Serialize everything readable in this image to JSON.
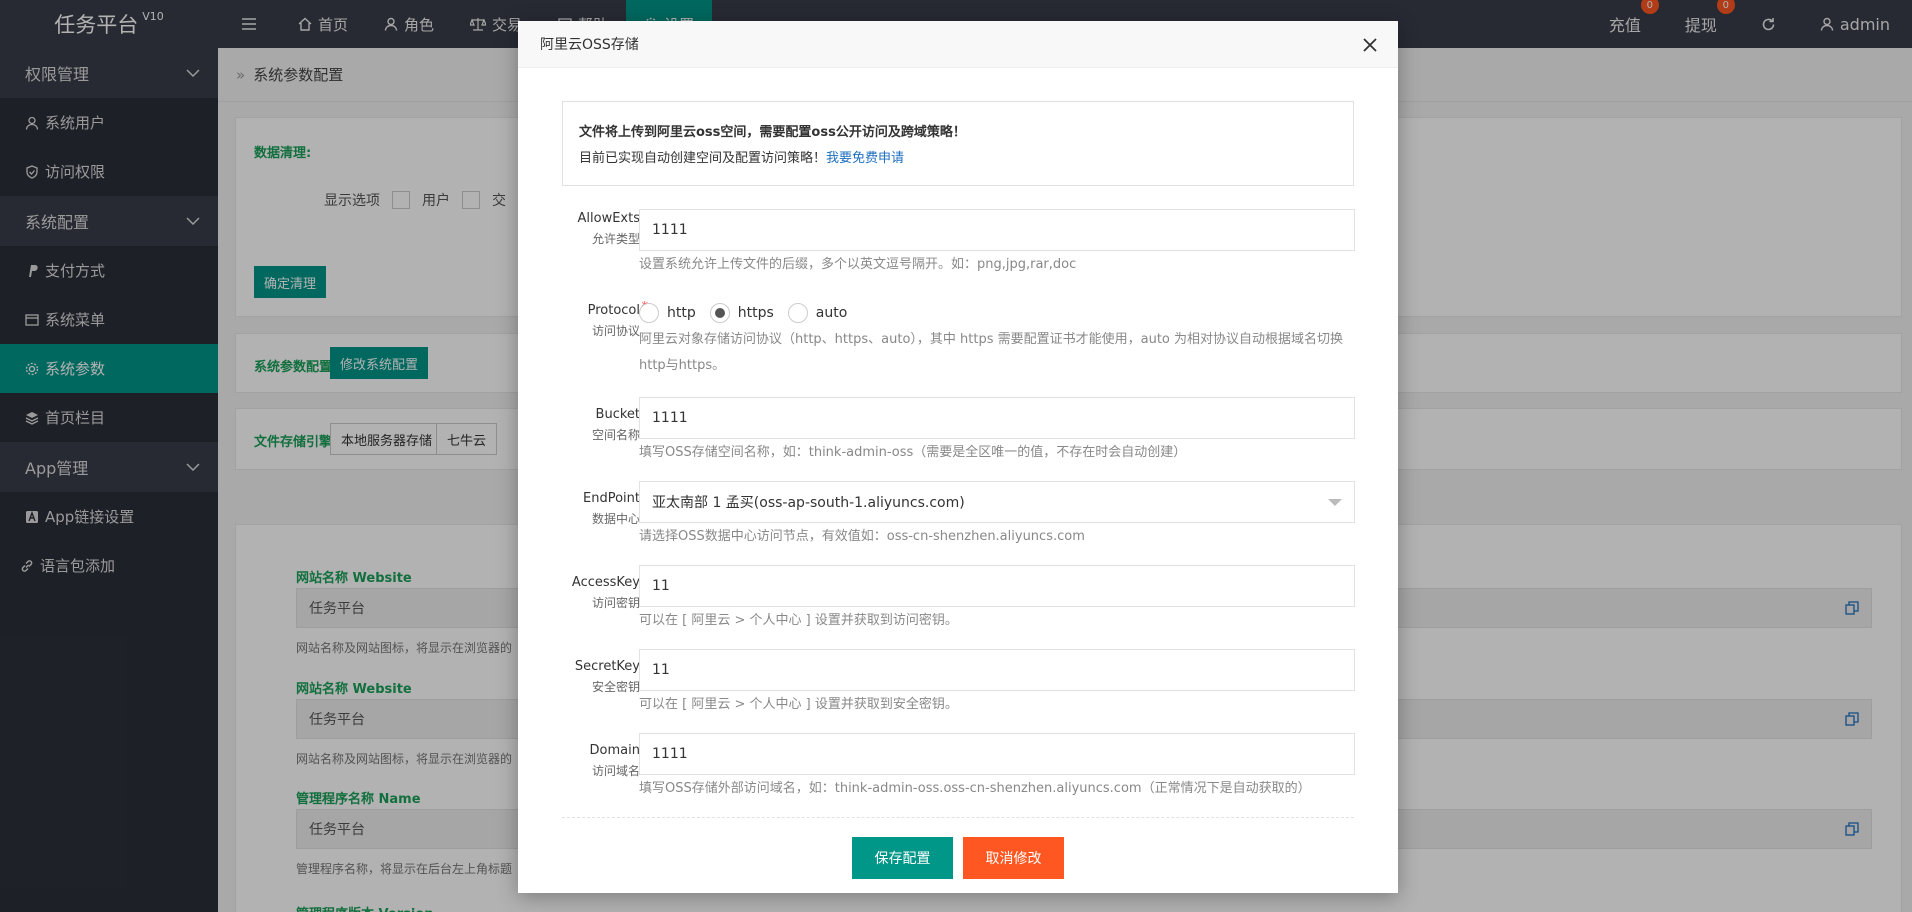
{
  "app": {
    "title": "任务平台",
    "version": "V10"
  },
  "topnav": {
    "items": [
      {
        "label": "首页",
        "icon": "home-icon"
      },
      {
        "label": "角色",
        "icon": "user-icon"
      },
      {
        "label": "交易",
        "icon": "scale-icon"
      },
      {
        "label": "帮助",
        "icon": "help-icon"
      },
      {
        "label": "设置",
        "icon": "gear-icon",
        "active": true
      }
    ]
  },
  "topright": {
    "recharge": {
      "label": "充值",
      "badge": "0"
    },
    "withdraw": {
      "label": "提现",
      "badge": "0"
    },
    "user": "admin"
  },
  "sidebar": {
    "group_permission": "权限管理",
    "item_users": "系统用户",
    "item_access": "访问权限",
    "group_config": "系统配置",
    "item_payment": "支付方式",
    "item_menu": "系统菜单",
    "item_params": "系统参数",
    "item_homecol": "首页栏目",
    "group_app": "App管理",
    "item_applink": "App链接设置",
    "item_lang": "语言包添加"
  },
  "content": {
    "breadcrumb": "系统参数配置",
    "clean": {
      "label": "数据清理:",
      "show_options": "显示选项",
      "opt_user": "用户",
      "opt_trade": "交",
      "confirm": "确定清理"
    },
    "sysparam": {
      "label": "系统参数配置:",
      "button": "修改系统配置"
    },
    "storage": {
      "label": "文件存储引擎:",
      "local": "本地服务器存储",
      "qiniu": "七牛云"
    },
    "website1": {
      "title": "网站名称 Website",
      "value": "任务平台",
      "hint": "网站名称及网站图标，将显示在浏览器的"
    },
    "website2": {
      "title": "网站名称 Website",
      "value": "任务平台",
      "hint": "网站名称及网站图标，将显示在浏览器的"
    },
    "appname": {
      "title": "管理程序名称 Name",
      "value": "任务平台",
      "hint": "管理程序名称，将显示在后台左上角标题"
    },
    "version_title": "管理程序版本 Version"
  },
  "modal": {
    "title": "阿里云OSS存储",
    "notice_line1": "文件将上传到阿里云oss空间，需要配置oss公开访问及跨域策略！",
    "notice_line2": "目前已实现自动创建空间及配置访问策略！",
    "notice_link": "我要免费申请",
    "fields": {
      "allowexts": {
        "label": "AllowExts",
        "sub": "允许类型",
        "value": "1111",
        "hint": "设置系统允许上传文件的后缀，多个以英文逗号隔开。如：png,jpg,rar,doc"
      },
      "protocol": {
        "label": "Protocol",
        "sub": "访问协议",
        "options": [
          "http",
          "https",
          "auto"
        ],
        "selected": "https",
        "hint": "阿里云对象存储访问协议（http、https、auto），其中 https 需要配置证书才能使用，auto 为相对协议自动根据域名切换http与https。"
      },
      "bucket": {
        "label": "Bucket",
        "sub": "空间名称",
        "value": "1111",
        "hint": "填写OSS存储空间名称，如：think-admin-oss（需要是全区唯一的值，不存在时会自动创建）"
      },
      "endpoint": {
        "label": "EndPoint",
        "sub": "数据中心",
        "value": "亚太南部 1 孟买(oss-ap-south-1.aliyuncs.com)",
        "hint": "请选择OSS数据中心访问节点，有效值如：oss-cn-shenzhen.aliyuncs.com"
      },
      "accesskey": {
        "label": "AccessKey",
        "sub": "访问密钥",
        "value": "11",
        "hint": "可以在 [ 阿里云 > 个人中心 ] 设置并获取到访问密钥。"
      },
      "secretkey": {
        "label": "SecretKey",
        "sub": "安全密钥",
        "value": "11",
        "hint": "可以在 [ 阿里云 > 个人中心 ] 设置并获取到安全密钥。"
      },
      "domain": {
        "label": "Domain",
        "sub": "访问域名",
        "value": "1111",
        "hint": "填写OSS存储外部访问域名，如：think-admin-oss.oss-cn-shenzhen.aliyuncs.com（正常情况下是自动获取的）"
      }
    },
    "save": "保存配置",
    "cancel": "取消修改"
  }
}
